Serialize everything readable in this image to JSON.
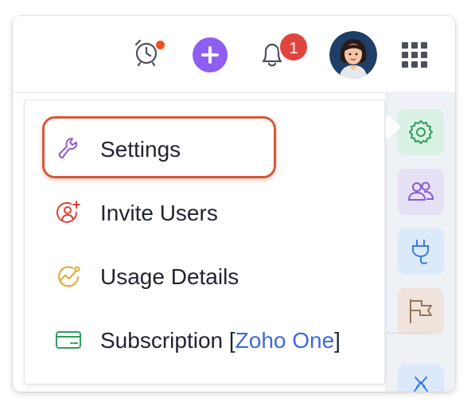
{
  "topbar": {
    "notification_count": "1",
    "icons": [
      "alarm-clock-icon",
      "plus-icon",
      "bell-icon",
      "avatar",
      "apps-grid-icon"
    ]
  },
  "menu": {
    "items": [
      {
        "label": "Settings",
        "icon": "wrench-icon",
        "selected": true
      },
      {
        "label": "Invite Users",
        "icon": "add-user-icon"
      },
      {
        "label": "Usage Details",
        "icon": "usage-chart-icon"
      },
      {
        "label": "Subscription [",
        "accent": "Zoho One",
        "suffix": "]",
        "icon": "card-icon"
      }
    ]
  },
  "rail": {
    "items": [
      "gear-icon",
      "users-icon",
      "plug-icon",
      "flag-icon",
      "puzzle-icon"
    ]
  },
  "colors": {
    "accent_link": "#3f6ad9",
    "highlight_border": "#d4583a",
    "plus_button": "#8e5ef0",
    "badge": "#e0453d"
  }
}
